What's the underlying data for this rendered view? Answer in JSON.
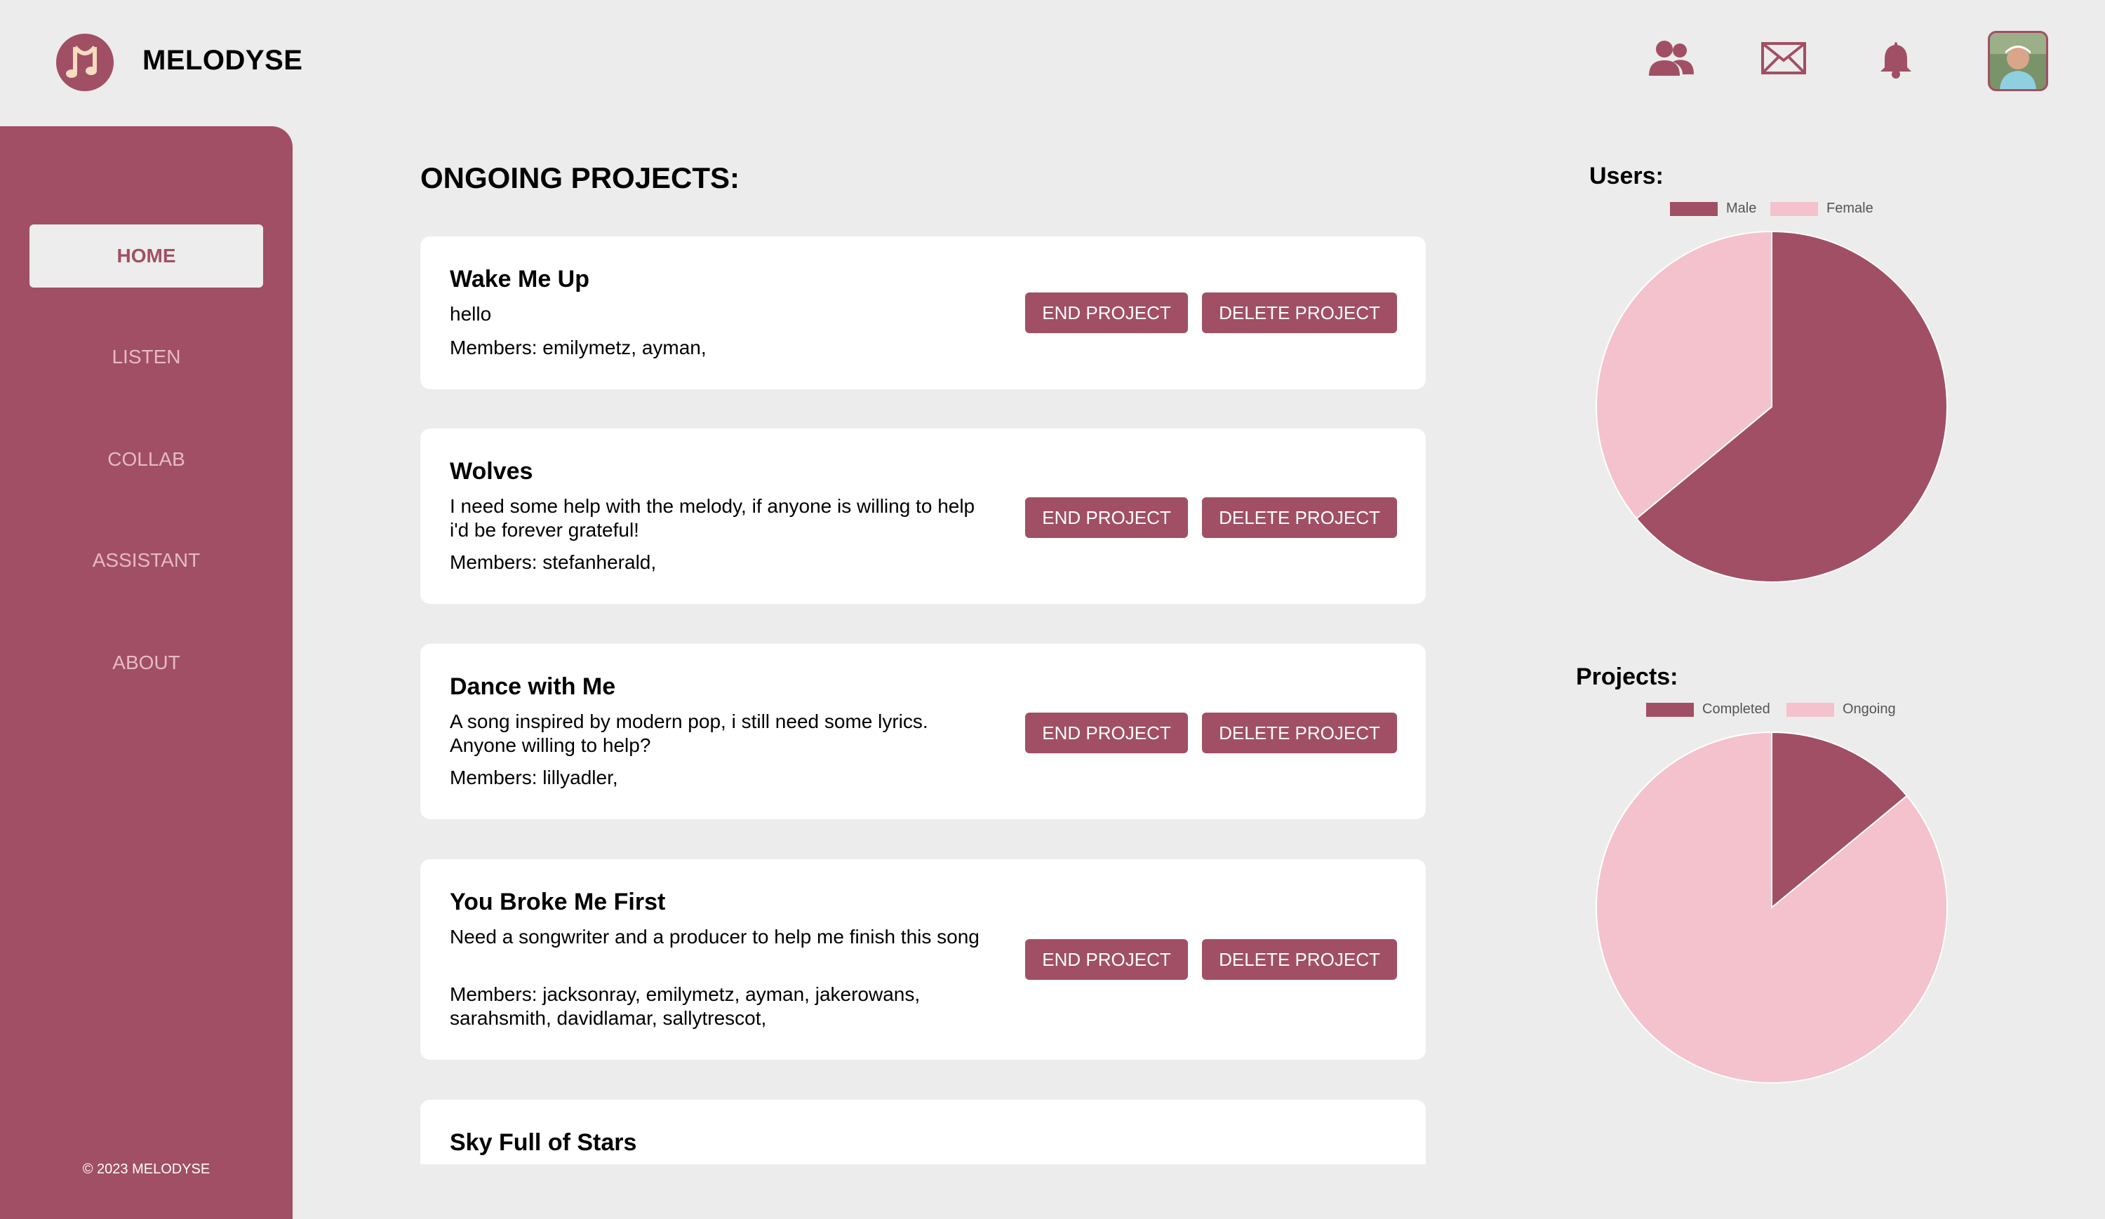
{
  "app": {
    "name": "MELODYSE",
    "logo_icon": "music-note-icon",
    "accent": "#a14f64",
    "accent_light": "#f4c2cc"
  },
  "header": {
    "icons": [
      "users-icon",
      "mail-icon",
      "bell-icon"
    ],
    "avatar": "profile-avatar"
  },
  "sidebar": {
    "items": [
      {
        "label": "HOME",
        "active": true
      },
      {
        "label": "LISTEN"
      },
      {
        "label": "COLLAB"
      },
      {
        "label": "ASSISTANT"
      },
      {
        "label": "ABOUT"
      }
    ],
    "copyright": "© 2023 MELODYSE"
  },
  "main": {
    "title": "ONGOING PROJECTS:",
    "end_label": "END PROJECT",
    "delete_label": "DELETE PROJECT",
    "projects": [
      {
        "title": "Wake Me Up",
        "description": "hello",
        "members": "Members: emilymetz, ayman,"
      },
      {
        "title": "Wolves",
        "description": "I need some help with the melody, if anyone is willing to help i'd be forever grateful!",
        "members": "Members: stefanherald,"
      },
      {
        "title": "Dance with Me",
        "description": "A song inspired by modern pop, i still need some lyrics. Anyone willing to help?",
        "members": "Members: lillyadler,"
      },
      {
        "title": "You Broke Me First",
        "description": "Need a songwriter and a producer to help me finish this song",
        "members": "Members: jacksonray, emilymetz, ayman, jakerowans, sarahsmith, davidlamar, sallytrescot,"
      },
      {
        "title": "Sky Full of Stars"
      }
    ]
  },
  "chart_data": [
    {
      "type": "pie",
      "title": "Users:",
      "categories": [
        "Male",
        "Female"
      ],
      "values": [
        64,
        36
      ],
      "colors": [
        "#a14f64",
        "#f4c2cc"
      ],
      "legend": "top"
    },
    {
      "type": "pie",
      "title": "Projects:",
      "categories": [
        "Completed",
        "Ongoing"
      ],
      "values": [
        14,
        86
      ],
      "colors": [
        "#a14f64",
        "#f4c2cc"
      ],
      "legend": "top"
    }
  ]
}
